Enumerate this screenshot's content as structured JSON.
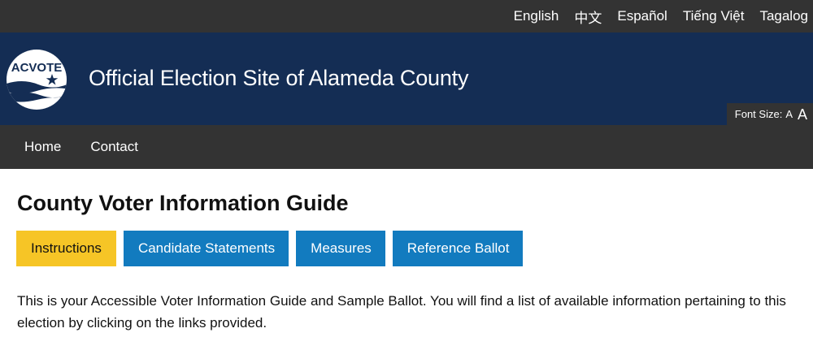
{
  "languages": [
    "English",
    "中文",
    "Español",
    "Tiếng Việt",
    "Tagalog"
  ],
  "logo": {
    "text": "ACVOTE"
  },
  "header": {
    "title": "Official Election Site of Alameda County",
    "font_size_label": "Font Size:",
    "font_size_small": "A",
    "font_size_large": "A"
  },
  "nav": {
    "home": "Home",
    "contact": "Contact"
  },
  "page": {
    "heading": "County Voter Information Guide",
    "tabs": [
      "Instructions",
      "Candidate Statements",
      "Measures",
      "Reference Ballot"
    ],
    "active_tab": "Instructions",
    "intro": "This is your Accessible Voter Information Guide and Sample Ballot. You will find a list of available information pertaining to this election by clicking on the links provided."
  },
  "colors": {
    "top_bar": "#333333",
    "header_bg": "#142d54",
    "tab_blue": "#127bbf",
    "tab_active": "#f6c526"
  }
}
